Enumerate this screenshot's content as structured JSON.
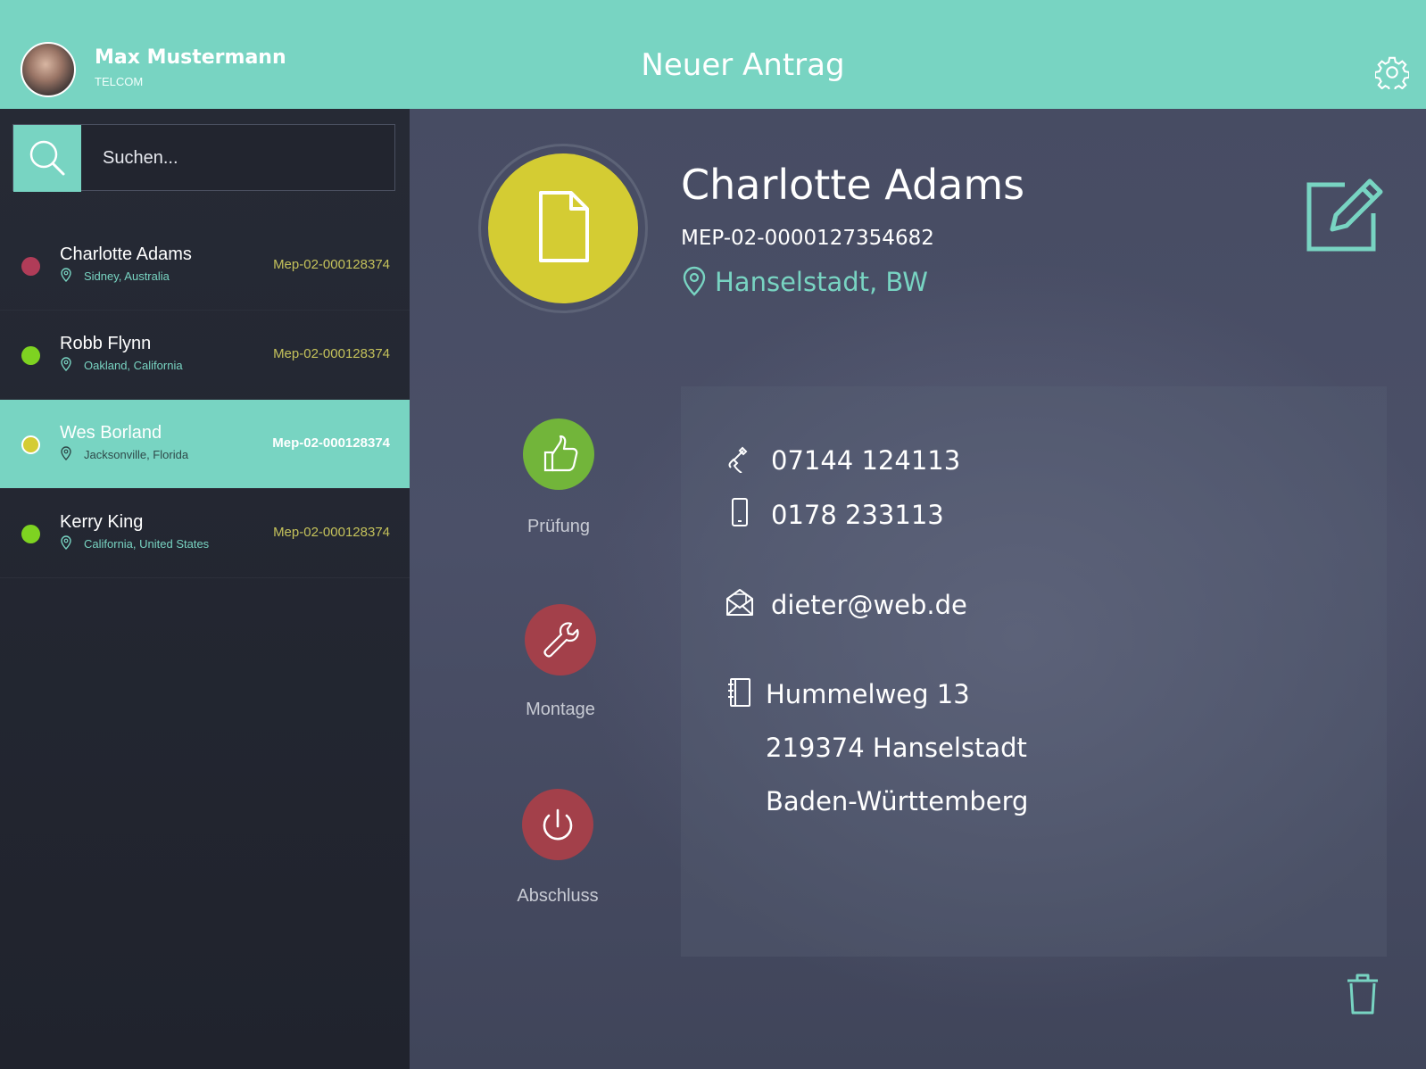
{
  "header": {
    "user_name": "Max Mustermann",
    "user_company": "TELCOM",
    "title": "Neuer Antrag"
  },
  "search": {
    "placeholder": "Suchen..."
  },
  "list": {
    "items": [
      {
        "name": "Charlotte Adams",
        "location": "Sidney, Australia",
        "id": "Mep-02-000128374",
        "status_color": "#b03c58",
        "active": false
      },
      {
        "name": "Robb Flynn",
        "location": "Oakland, California",
        "id": "Mep-02-000128374",
        "status_color": "#7ed321",
        "active": false
      },
      {
        "name": "Wes Borland",
        "location": "Jacksonville, Florida",
        "id": "Mep-02-000128374",
        "status_color": "#d4cc33",
        "active": true
      },
      {
        "name": "Kerry King",
        "location": "California, United States",
        "id": "Mep-02-000128374",
        "status_color": "#7ed321",
        "active": false
      }
    ]
  },
  "detail": {
    "name": "Charlotte Adams",
    "id": "MEP-02-0000127354682",
    "location": "Hanselstadt, BW",
    "phone": "07144 124113",
    "mobile": "0178 233113",
    "email": "dieter@web.de",
    "address_line1": "Hummelweg 13",
    "address_line2": "219374 Hanselstadt",
    "address_line3": "Baden-Württemberg"
  },
  "actions": {
    "pruefung_label": "Prüfung",
    "montage_label": "Montage",
    "abschluss_label": "Abschluss"
  },
  "colors": {
    "accent": "#78d4c2",
    "yellow": "#d4cc33",
    "green": "#7ed321",
    "red": "#b03c4a"
  }
}
